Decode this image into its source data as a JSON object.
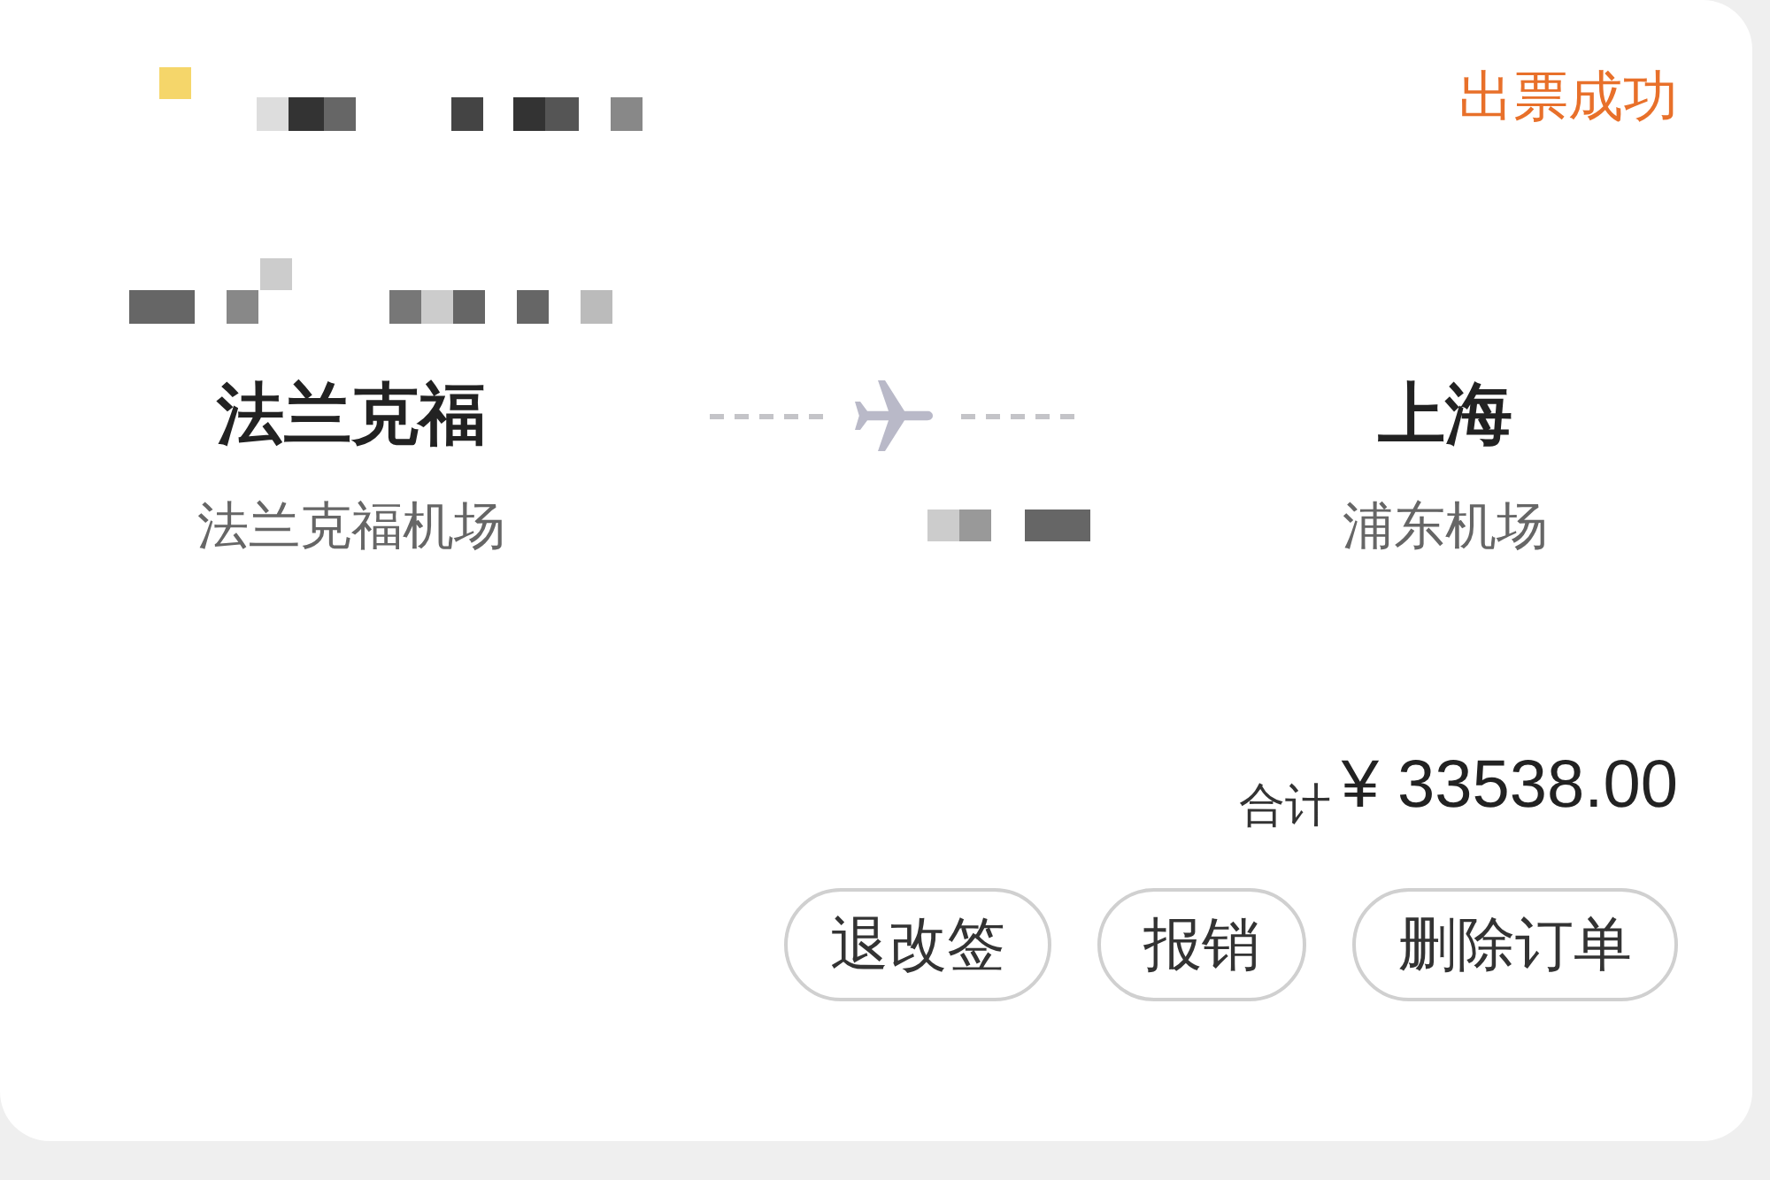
{
  "order": {
    "status": "出票成功",
    "departure": {
      "city": "法兰克福",
      "airport": "法兰克福机场"
    },
    "arrival": {
      "city": "上海",
      "airport": "浦东机场"
    },
    "total_label": "合计",
    "total_amount": "¥ 33538.00",
    "buttons": [
      {
        "label": "退改签"
      },
      {
        "label": "报销"
      },
      {
        "label": "删除订单"
      }
    ]
  }
}
